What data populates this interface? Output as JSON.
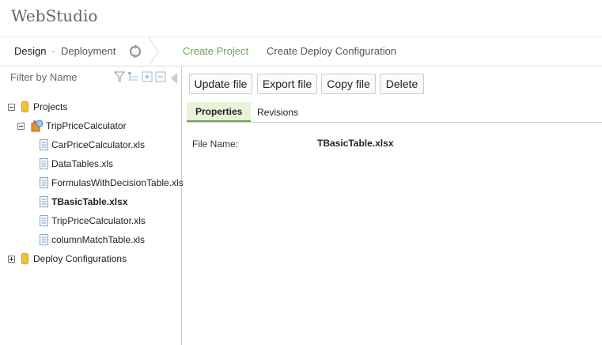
{
  "app": {
    "title": "WebStudio"
  },
  "nav": {
    "design": "Design",
    "separator": "-",
    "deployment": "Deployment",
    "create_project": "Create Project",
    "create_deploy_configuration": "Create Deploy Configuration"
  },
  "sidebar": {
    "filter_placeholder": "Filter by Name",
    "tree": {
      "projects": "Projects",
      "project_name": "TripPriceCalculator",
      "files": [
        "CarPriceCalculator.xls",
        "DataTables.xls",
        "FormulasWithDecisionTable.xls",
        "TBasicTable.xlsx",
        "TripPriceCalculator.xls",
        "columnMatchTable.xls"
      ],
      "selected_file": "TBasicTable.xlsx",
      "deploy_configurations": "Deploy Configurations"
    }
  },
  "toolbar": {
    "update_file": "Update file",
    "export_file": "Export file",
    "copy_file": "Copy file",
    "delete": "Delete"
  },
  "tabs": {
    "properties": "Properties",
    "revisions": "Revisions",
    "active": "Properties"
  },
  "properties": {
    "file_name_label": "File Name:",
    "file_name_value": "TBasicTable.xlsx"
  },
  "colors": {
    "accent_green": "#6aa84f",
    "tab_active_bg": "#e8f3d8",
    "db_icon": "#f1c232"
  }
}
